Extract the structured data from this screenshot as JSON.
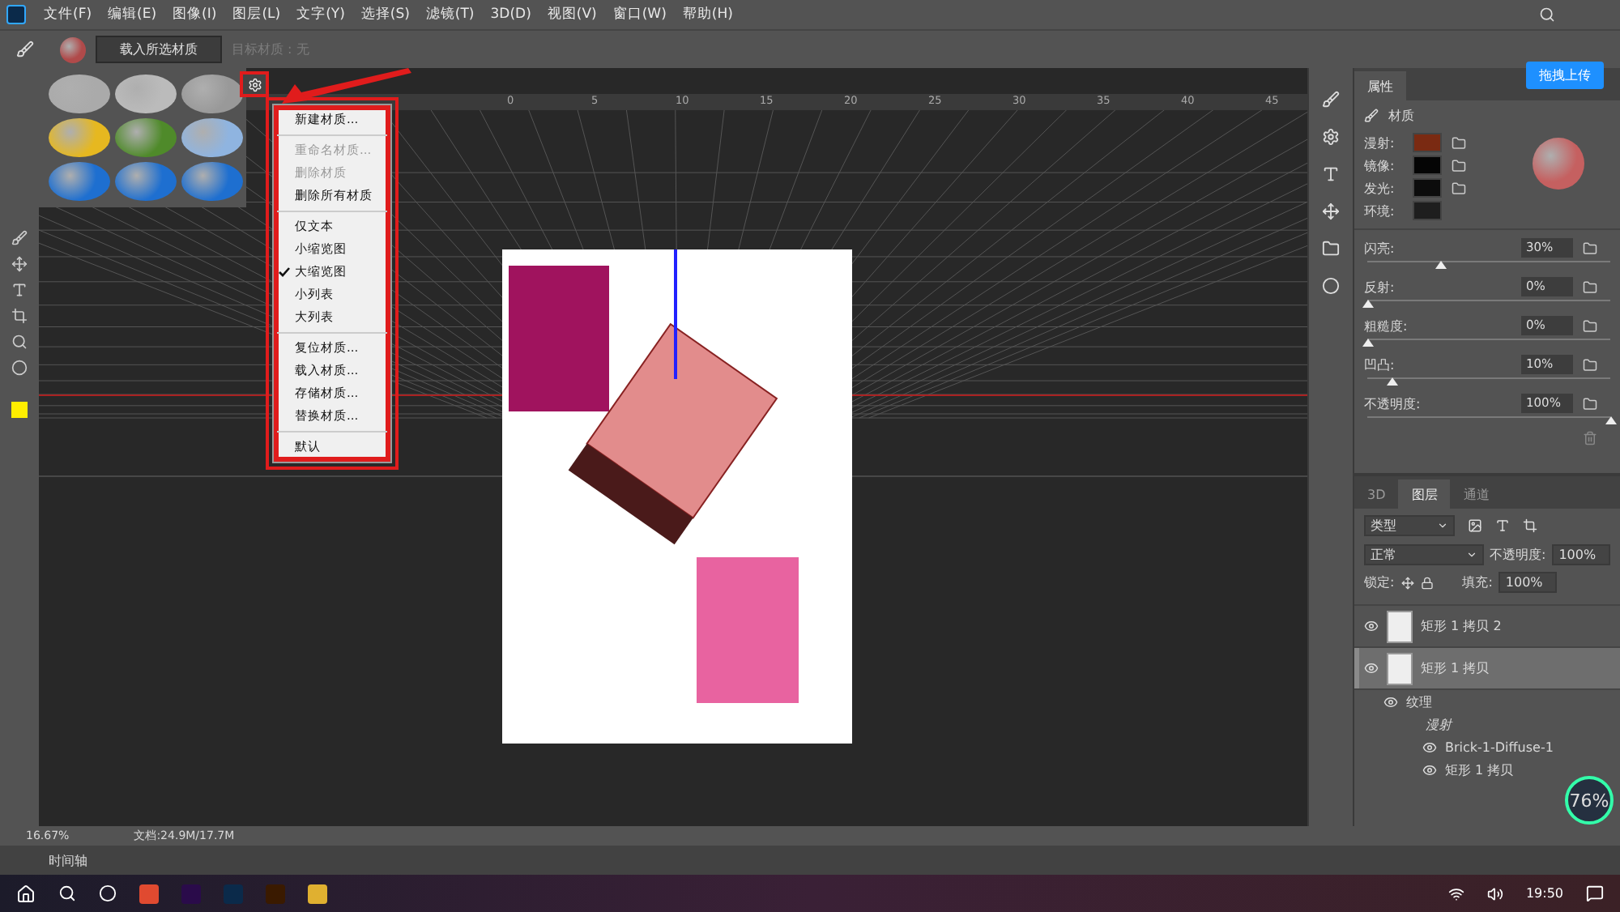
{
  "menu_bar": {
    "items": [
      "文件(F)",
      "编辑(E)",
      "图像(I)",
      "图层(L)",
      "文字(Y)",
      "选择(S)",
      "滤镜(T)",
      "3D(D)",
      "视图(V)",
      "窗口(W)",
      "帮助(H)"
    ]
  },
  "options_bar": {
    "load_button": "载入所选材质",
    "target_label": "目标材质 : 无"
  },
  "panel_menu": {
    "sections": [
      [
        {
          "label": "新建材质...",
          "disabled": false,
          "checked": false
        }
      ],
      [
        {
          "label": "重命名材质...",
          "disabled": true,
          "checked": false
        },
        {
          "label": "删除材质",
          "disabled": true,
          "checked": false
        },
        {
          "label": "删除所有材质",
          "disabled": false,
          "checked": false
        }
      ],
      [
        {
          "label": "仅文本",
          "disabled": false,
          "checked": false
        },
        {
          "label": "小缩览图",
          "disabled": false,
          "checked": false
        },
        {
          "label": "大缩览图",
          "disabled": false,
          "checked": true
        },
        {
          "label": "小列表",
          "disabled": false,
          "checked": false
        },
        {
          "label": "大列表",
          "disabled": false,
          "checked": false
        }
      ],
      [
        {
          "label": "复位材质...",
          "disabled": false,
          "checked": false
        },
        {
          "label": "载入材质...",
          "disabled": false,
          "checked": false
        },
        {
          "label": "存储材质...",
          "disabled": false,
          "checked": false
        },
        {
          "label": "替换材质...",
          "disabled": false,
          "checked": false
        }
      ],
      [
        {
          "label": "默认",
          "disabled": false,
          "checked": false
        }
      ]
    ]
  },
  "ruler": {
    "labels": [
      "0",
      "5",
      "10",
      "15",
      "20",
      "25",
      "30",
      "35",
      "40",
      "45"
    ]
  },
  "upload_button": "拖拽上传",
  "properties": {
    "tab": "属性",
    "header": "材质",
    "textures": [
      {
        "label": "漫射:",
        "color": "#7a2a12"
      },
      {
        "label": "镜像:",
        "color": "#050505"
      },
      {
        "label": "发光:",
        "color": "#0c0c0c"
      },
      {
        "label": "环境:",
        "color": "#1e1e1e"
      }
    ],
    "sliders": [
      {
        "label": "闪亮:",
        "value": "30%",
        "level": 0.3
      },
      {
        "label": "反射:",
        "value": "0%",
        "level": 0
      },
      {
        "label": "粗糙度:",
        "value": "0%",
        "level": 0
      },
      {
        "label": "凹凸:",
        "value": "10%",
        "level": 0.1
      },
      {
        "label": "不透明度:",
        "value": "100%",
        "level": 1
      }
    ]
  },
  "layers": {
    "tabs": [
      {
        "label": "3D",
        "selected": false
      },
      {
        "label": "图层",
        "selected": true
      },
      {
        "label": "通道",
        "selected": false
      }
    ],
    "filter": "类型",
    "blend_mode": "正常",
    "opacity_label": "不透明度:",
    "opacity": "100%",
    "lock_label": "锁定:",
    "fill_label": "填充:",
    "fill": "100%",
    "items": [
      {
        "name": "矩形 1 拷贝 2",
        "selected": false,
        "visible": true
      },
      {
        "name": "矩形 1 拷贝",
        "selected": true,
        "visible": true,
        "children": [
          {
            "name": "纹理",
            "visible": true,
            "children": [
              {
                "name": "漫射",
                "visible": false,
                "children": [
                  {
                    "name": "Brick-1-Diffuse-1",
                    "visible": true
                  },
                  {
                    "name": "矩形 1 拷贝",
                    "visible": true
                  }
                ]
              }
            ]
          }
        ]
      }
    ]
  },
  "status_bar": {
    "zoom": "16.67%",
    "doc": "文档:24.9M/17.7M",
    "timeline_tab": "时间轴"
  },
  "net_meter": "76%",
  "taskbar": {
    "time": "19:50"
  }
}
